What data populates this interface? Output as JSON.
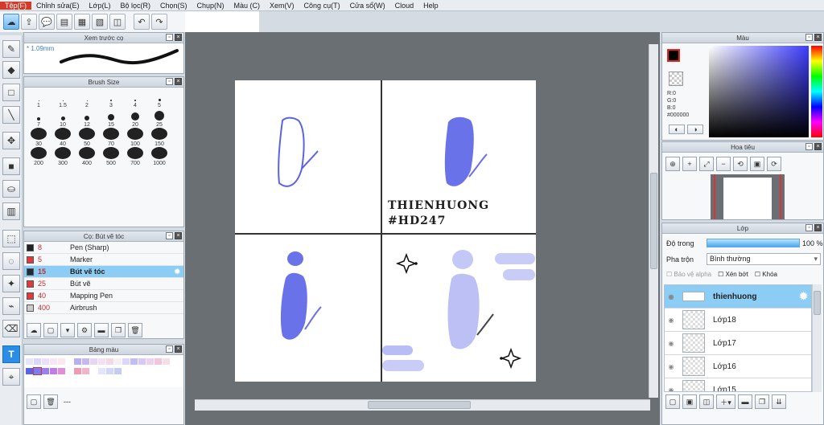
{
  "menu": [
    "Tệp(F)",
    "Chỉnh sửa(E)",
    "Lớp(L)",
    "Bộ lọc(R)",
    "Chọn(S)",
    "Chụp(N)",
    "Màu (C)",
    "Xem(V)",
    "Công cụ(T)",
    "Cửa sổ(W)",
    "Cloud",
    "Help"
  ],
  "brush_preview": {
    "title": "Xem trước cọ",
    "size": "* 1.09mm"
  },
  "brush_size": {
    "title": "Brush Size",
    "sizes": [
      "1",
      "1.5",
      "2",
      "3",
      "4",
      "5",
      "7",
      "10",
      "12",
      "15",
      "20",
      "25",
      "30",
      "40",
      "50",
      "70",
      "100",
      "150",
      "200",
      "300",
      "400",
      "500",
      "700",
      "1000"
    ]
  },
  "brush_list": {
    "title": "Cọ: Bút vẽ tóc",
    "items": [
      {
        "size": "8",
        "name": "Pen (Sharp)",
        "color": "#222222"
      },
      {
        "size": "5",
        "name": "Marker",
        "color": "#e03a3a"
      },
      {
        "size": "15",
        "name": "Bút vẽ tóc",
        "color": "#1e2b3a"
      },
      {
        "size": "25",
        "name": "Bút vẽ",
        "color": "#e03a3a"
      },
      {
        "size": "40",
        "name": "Mapping Pen",
        "color": "#e03a3a"
      },
      {
        "size": "400",
        "name": "Airbrush",
        "color": "#cccccc"
      }
    ]
  },
  "palette": {
    "title": "Bảng màu",
    "footer": "---"
  },
  "watermark": {
    "line1": "THIENHUONG",
    "line2": "#HD247"
  },
  "color_panel": {
    "title": "Màu",
    "r": "R:0",
    "g": "G:0",
    "b": "B:0",
    "hex": "#000000",
    "accent": "#e3261f"
  },
  "navigator": {
    "title": "Hoa tiêu"
  },
  "layers": {
    "title": "Lớp",
    "opacity_label": "Độ trong",
    "opacity_value": "100 %",
    "blend_label": "Pha trộn",
    "blend_value": "Bình thường",
    "protect_alpha": "Bảo vệ alpha",
    "clipping": "Xén bớt",
    "lock": "Khóa",
    "items": [
      "thienhuong",
      "Lớp18",
      "Lớp17",
      "Lớp16",
      "Lớp15"
    ]
  }
}
